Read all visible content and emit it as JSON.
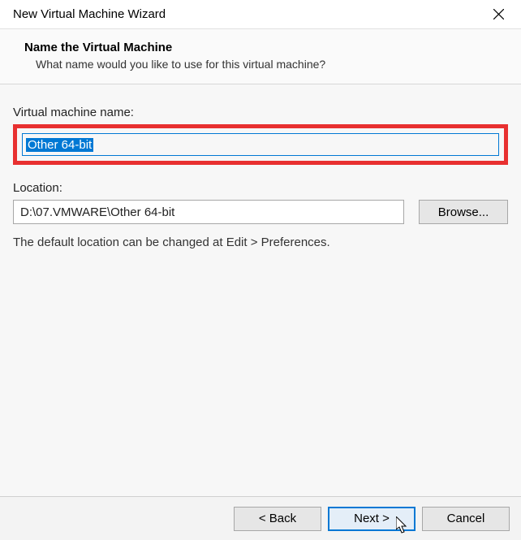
{
  "window": {
    "title": "New Virtual Machine Wizard"
  },
  "header": {
    "title": "Name the Virtual Machine",
    "subtitle": "What name would you like to use for this virtual machine?"
  },
  "form": {
    "vmname_label": "Virtual machine name:",
    "vmname_value": "Other 64-bit",
    "location_label": "Location:",
    "location_value": "D:\\07.VMWARE\\Other 64-bit",
    "browse_label": "Browse...",
    "hint": "The default location can be changed at Edit > Preferences."
  },
  "buttons": {
    "back": "< Back",
    "next": "Next >",
    "cancel": "Cancel"
  }
}
